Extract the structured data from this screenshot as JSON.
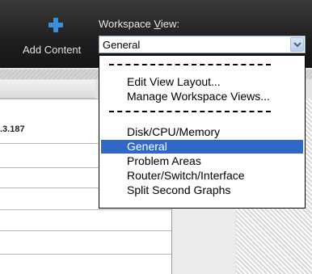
{
  "toolbar": {
    "add_content_label": "Add Content",
    "add_icon": "plus-icon",
    "workspace_view_label_pre": "Workspace ",
    "workspace_view_label_underlined": "V",
    "workspace_view_label_post": "iew:",
    "selected_view": "General"
  },
  "background": {
    "row_text": ".3.187"
  },
  "dropdown": {
    "actions": [
      {
        "label": "Edit View Layout..."
      },
      {
        "label": "Manage Workspace Views..."
      }
    ],
    "views": [
      {
        "label": "Disk/CPU/Memory",
        "selected": false
      },
      {
        "label": "General",
        "selected": true
      },
      {
        "label": "Problem Areas",
        "selected": false
      },
      {
        "label": "Router/Switch/Interface",
        "selected": false
      },
      {
        "label": "Split Second Graphs",
        "selected": false
      }
    ]
  },
  "colors": {
    "selection": "#3168c6",
    "toolbar_bg": "#1e1e1e",
    "plus_icon": "#3a8fd6"
  }
}
